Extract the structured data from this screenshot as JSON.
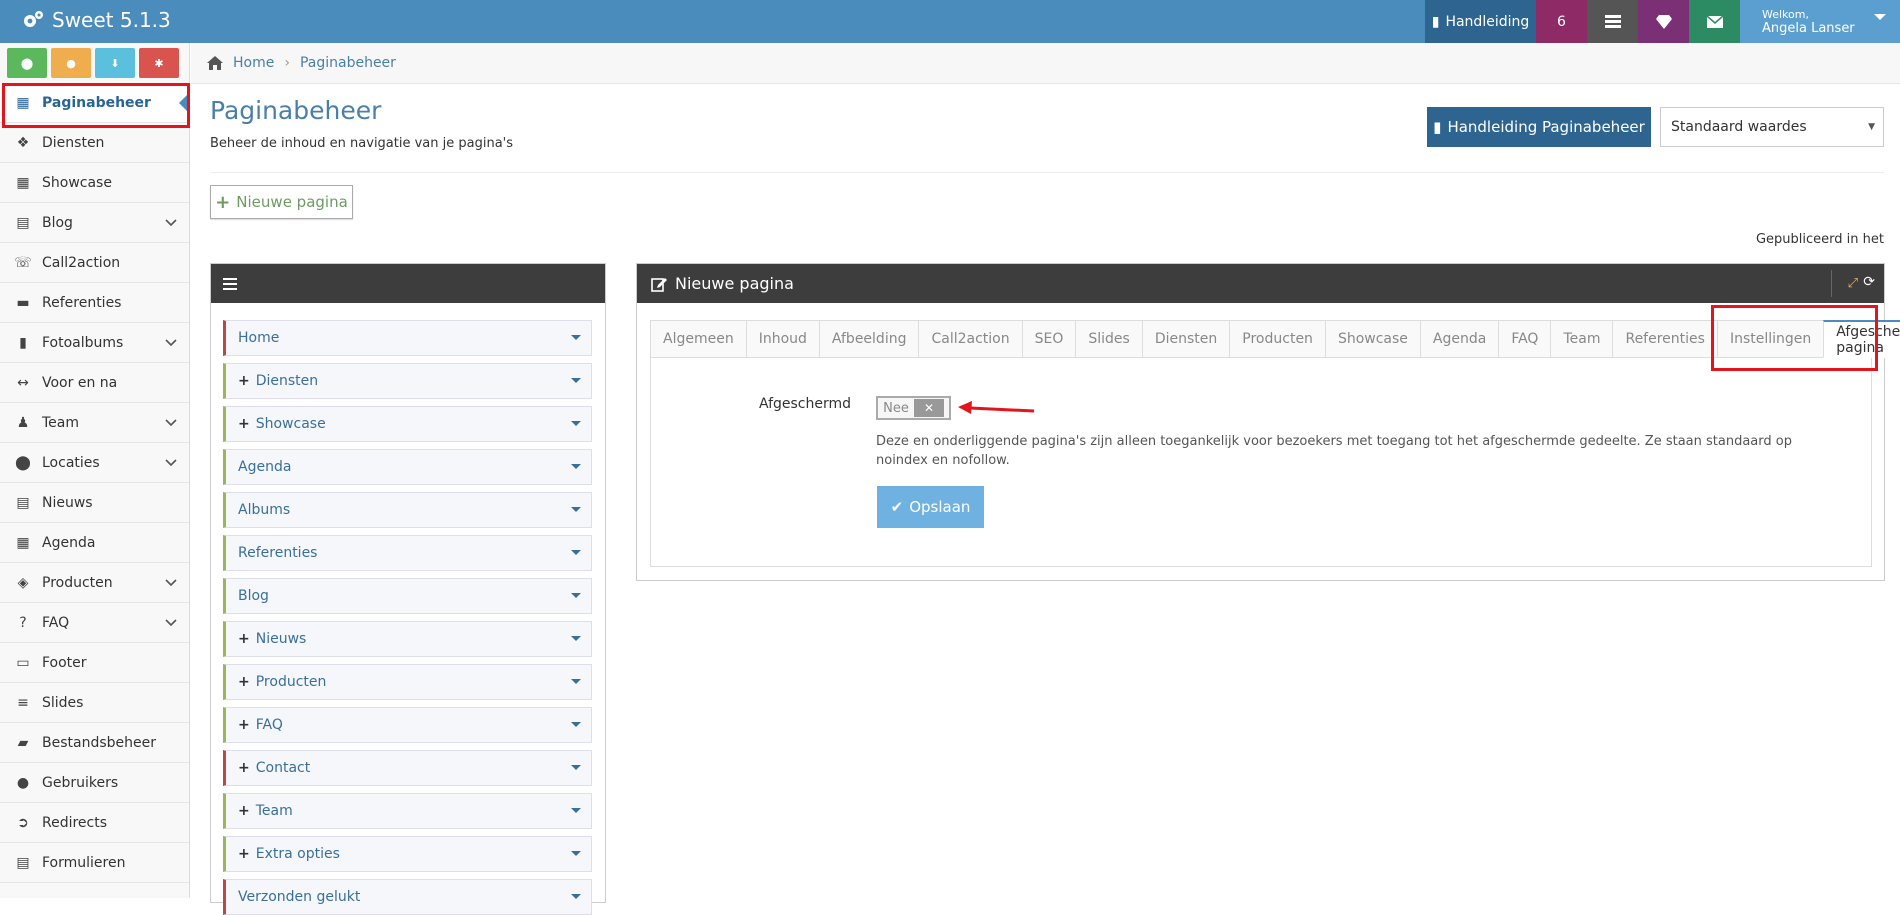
{
  "app": {
    "title": "Sweet 5.1.3"
  },
  "topbar": {
    "manual_label": "Handleiding",
    "badge_count": "6",
    "welcome_label": "Welkom,",
    "user_name": "Angela Lanser"
  },
  "colors": {
    "topbar": "#4a8cbb",
    "badge": "#8e2a66",
    "dark": "#555555",
    "purple": "#7b3075",
    "green": "#2c8b63",
    "user_bg": "#5b9fd1",
    "accent": "#e3141b"
  },
  "sidebar": {
    "quick_buttons": [
      {
        "icon": "map-marker-icon",
        "color": "#5cb85c"
      },
      {
        "icon": "user-icon",
        "color": "#f0ad4e"
      },
      {
        "icon": "download-icon",
        "color": "#5bc0de"
      },
      {
        "icon": "cogs-icon",
        "color": "#d9534f"
      }
    ],
    "items": [
      {
        "label": "Paginabeheer",
        "icon": "table-icon",
        "active": true,
        "expandable": false
      },
      {
        "label": "Diensten",
        "icon": "cubes-icon",
        "expandable": false
      },
      {
        "label": "Showcase",
        "icon": "grid-icon",
        "expandable": false
      },
      {
        "label": "Blog",
        "icon": "file-icon",
        "expandable": true
      },
      {
        "label": "Call2action",
        "icon": "phone-icon",
        "expandable": false
      },
      {
        "label": "Referenties",
        "icon": "comments-icon",
        "expandable": false
      },
      {
        "label": "Fotoalbums",
        "icon": "book-icon",
        "expandable": true
      },
      {
        "label": "Voor en na",
        "icon": "arrows-h-icon",
        "expandable": false
      },
      {
        "label": "Team",
        "icon": "users-icon",
        "expandable": true
      },
      {
        "label": "Locaties",
        "icon": "map-marker-icon",
        "expandable": true
      },
      {
        "label": "Nieuws",
        "icon": "newspaper-icon",
        "expandable": false
      },
      {
        "label": "Agenda",
        "icon": "calendar-icon",
        "expandable": false
      },
      {
        "label": "Producten",
        "icon": "tags-icon",
        "expandable": true
      },
      {
        "label": "FAQ",
        "icon": "question-icon",
        "expandable": true
      },
      {
        "label": "Footer",
        "icon": "footer-icon",
        "expandable": false
      },
      {
        "label": "Slides",
        "icon": "sliders-icon",
        "expandable": false
      },
      {
        "label": "Bestandsbeheer",
        "icon": "folder-icon",
        "expandable": false
      },
      {
        "label": "Gebruikers",
        "icon": "user-icon",
        "expandable": false
      },
      {
        "label": "Redirects",
        "icon": "redirect-icon",
        "expandable": false
      },
      {
        "label": "Formulieren",
        "icon": "form-icon",
        "expandable": false
      }
    ]
  },
  "breadcrumb": {
    "home": "Home",
    "current": "Paginabeheer"
  },
  "page": {
    "title": "Paginabeheer",
    "subtitle": "Beheer de inhoud en navigatie van je pagina's",
    "manual_button": "Handleiding Paginabeheer",
    "select_value": "Standaard waardes",
    "new_page_button": "Nieuwe pagina",
    "published_label": "Gepubliceerd in het"
  },
  "tree": {
    "items": [
      {
        "label": "Home",
        "plus": false,
        "red": true
      },
      {
        "label": "Diensten",
        "plus": true,
        "red": false
      },
      {
        "label": "Showcase",
        "plus": true,
        "red": false
      },
      {
        "label": "Agenda",
        "plus": false,
        "red": false
      },
      {
        "label": "Albums",
        "plus": false,
        "red": false
      },
      {
        "label": "Referenties",
        "plus": false,
        "red": false
      },
      {
        "label": "Blog",
        "plus": false,
        "red": false
      },
      {
        "label": "Nieuws",
        "plus": true,
        "red": false
      },
      {
        "label": "Producten",
        "plus": true,
        "red": false
      },
      {
        "label": "FAQ",
        "plus": true,
        "red": false
      },
      {
        "label": "Contact",
        "plus": true,
        "red": true
      },
      {
        "label": "Team",
        "plus": true,
        "red": false
      },
      {
        "label": "Extra opties",
        "plus": true,
        "red": false
      },
      {
        "label": "Verzonden gelukt",
        "plus": false,
        "red": true
      }
    ]
  },
  "editor": {
    "title": "Nieuwe pagina",
    "tabs": [
      "Algemeen",
      "Inhoud",
      "Afbeelding",
      "Call2action",
      "SEO",
      "Slides",
      "Diensten",
      "Producten",
      "Showcase",
      "Agenda",
      "FAQ",
      "Team",
      "Referenties",
      "Instellingen",
      "Afgeschermde pagina"
    ],
    "active_tab": "Afgeschermde pagina",
    "field_label": "Afgeschermd",
    "toggle_value": "Nee",
    "description": "Deze en onderliggende pagina's zijn alleen toegankelijk voor bezoekers met toegang tot het afgeschermde gedeelte. Ze staan standaard op noindex en nofollow.",
    "save_button": "Opslaan"
  }
}
